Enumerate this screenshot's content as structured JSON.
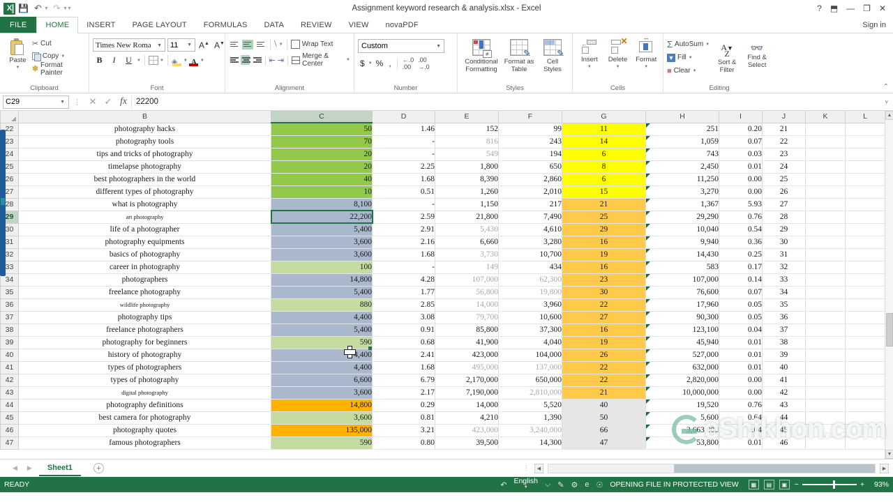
{
  "window": {
    "title": "Assignment keyword research & analysis.xlsx - Excel",
    "help": "?",
    "ribbon_display": "⬒",
    "minimize": "—",
    "restore": "❐",
    "close": "✕",
    "signin": "Sign in"
  },
  "qat": {
    "logo": "X",
    "save": "💾",
    "undo": "↶",
    "redo": "↷",
    "customize": "≡"
  },
  "tabs": [
    {
      "label": "FILE",
      "active": false
    },
    {
      "label": "HOME",
      "active": true
    },
    {
      "label": "INSERT",
      "active": false
    },
    {
      "label": "PAGE LAYOUT",
      "active": false
    },
    {
      "label": "FORMULAS",
      "active": false
    },
    {
      "label": "DATA",
      "active": false
    },
    {
      "label": "REVIEW",
      "active": false
    },
    {
      "label": "VIEW",
      "active": false
    },
    {
      "label": "novaPDF",
      "active": false
    }
  ],
  "ribbon": {
    "clipboard": {
      "label": "Clipboard",
      "paste": "Paste",
      "cut": "Cut",
      "copy": "Copy",
      "format_painter": "Format Painter",
      "launcher": "⤵"
    },
    "font": {
      "label": "Font",
      "font_name": "Times New Roma",
      "font_size": "11",
      "grow": "A",
      "shrink": "A",
      "bold": "B",
      "italic": "I",
      "underline": "U",
      "borders": "borders",
      "fill_color": "fill-color",
      "font_color": "A",
      "launcher": "⤵"
    },
    "alignment": {
      "label": "Alignment",
      "wrap_text": "Wrap Text",
      "merge_center": "Merge & Center",
      "launcher": "⤵"
    },
    "number": {
      "label": "Number",
      "format": "Custom",
      "currency": "$",
      "percent": "%",
      "comma": ",",
      "inc_dec": ".00",
      "dec_dec": ".0",
      "launcher": "⤵"
    },
    "styles": {
      "label": "Styles",
      "conditional_formatting": "Conditional\nFormatting",
      "conditional_formatting_l1": "Conditional",
      "conditional_formatting_l2": "Formatting",
      "format_as_table_l1": "Format as",
      "format_as_table_l2": "Table",
      "cell_styles_l1": "Cell",
      "cell_styles_l2": "Styles"
    },
    "cells": {
      "label": "Cells",
      "insert": "Insert",
      "delete": "Delete",
      "format": "Format"
    },
    "editing": {
      "label": "Editing",
      "autosum": "AutoSum",
      "fill": "Fill",
      "clear": "Clear",
      "sort_filter_l1": "Sort &",
      "sort_filter_l2": "Filter",
      "find_select_l1": "Find &",
      "find_select_l2": "Select"
    },
    "collapse": "⌃"
  },
  "formula_bar": {
    "name_box": "C29",
    "cancel": "✕",
    "enter": "✓",
    "insert_function": "fx",
    "value": "22200",
    "expand": "˅"
  },
  "grid": {
    "columns": [
      {
        "id": "B",
        "selected": false
      },
      {
        "id": "C",
        "selected": true
      },
      {
        "id": "D",
        "selected": false
      },
      {
        "id": "E",
        "selected": false
      },
      {
        "id": "F",
        "selected": false
      },
      {
        "id": "G",
        "selected": false
      },
      {
        "id": "H",
        "selected": false
      },
      {
        "id": "I",
        "selected": false
      },
      {
        "id": "J",
        "selected": false
      },
      {
        "id": "K",
        "selected": false
      },
      {
        "id": "L",
        "selected": false
      },
      {
        "id": "M",
        "selected": false
      }
    ],
    "selected_cell": "C29",
    "colors": {
      "green_fill": "#92c94a",
      "light_green_fill": "#c4dca0",
      "blue_gray_fill": "#a9b8cc",
      "yellow_fill": "#ffff00",
      "orange_fill": "#ffc94a",
      "orange_strong_fill": "#ffb300",
      "gray_fill": "#e6e6e6",
      "accent": "#217346"
    },
    "rows": [
      {
        "n": "22",
        "B": "photography hacks",
        "C": "50",
        "D": "1.46",
        "E": "152",
        "F": "99",
        "G": "11",
        "H": "251",
        "I": "0.20",
        "J": "21",
        "cfill": "green",
        "gfill": "yellow",
        "emuted": false,
        "fmuted": false,
        "bsmall": false
      },
      {
        "n": "23",
        "B": "photography tools",
        "C": "70",
        "D": "-",
        "E": "816",
        "F": "243",
        "G": "14",
        "H": "1,059",
        "I": "0.07",
        "J": "22",
        "cfill": "green",
        "gfill": "yellow",
        "emuted": true,
        "fmuted": false,
        "bsmall": false
      },
      {
        "n": "24",
        "B": "tips and tricks of photography",
        "C": "20",
        "D": "-",
        "E": "549",
        "F": "194",
        "G": "6",
        "H": "743",
        "I": "0.03",
        "J": "23",
        "cfill": "green",
        "gfill": "yellow",
        "emuted": true,
        "fmuted": false,
        "bsmall": false
      },
      {
        "n": "25",
        "B": "timelapse photography",
        "C": "20",
        "D": "2.25",
        "E": "1,800",
        "F": "650",
        "G": "8",
        "H": "2,450",
        "I": "0.01",
        "J": "24",
        "cfill": "green",
        "gfill": "yellow",
        "emuted": false,
        "fmuted": false,
        "bsmall": false
      },
      {
        "n": "26",
        "B": "best photographers in the world",
        "C": "40",
        "D": "1.68",
        "E": "8,390",
        "F": "2,860",
        "G": "6",
        "H": "11,250",
        "I": "0.00",
        "J": "25",
        "cfill": "green",
        "gfill": "yellow",
        "emuted": false,
        "fmuted": false,
        "bsmall": false
      },
      {
        "n": "27",
        "B": "different types of photography",
        "C": "10",
        "D": "0.51",
        "E": "1,260",
        "F": "2,010",
        "G": "15",
        "H": "3,270",
        "I": "0.00",
        "J": "26",
        "cfill": "green",
        "gfill": "yellow",
        "emuted": false,
        "fmuted": false,
        "bsmall": false
      },
      {
        "n": "28",
        "B": "what is photography",
        "C": "8,100",
        "D": "-",
        "E": "1,150",
        "F": "217",
        "G": "21",
        "H": "1,367",
        "I": "5.93",
        "J": "27",
        "cfill": "bluegray",
        "gfill": "orange",
        "emuted": false,
        "fmuted": false,
        "bsmall": false
      },
      {
        "n": "29",
        "B": "art photography",
        "C": "22,200",
        "D": "2.59",
        "E": "21,800",
        "F": "7,490",
        "G": "25",
        "H": "29,290",
        "I": "0.76",
        "J": "28",
        "cfill": "bluegray",
        "gfill": "orange",
        "emuted": false,
        "fmuted": false,
        "bsmall": true,
        "selected": true
      },
      {
        "n": "30",
        "B": "life of a photographer",
        "C": "5,400",
        "D": "2.91",
        "E": "5,430",
        "F": "4,610",
        "G": "29",
        "H": "10,040",
        "I": "0.54",
        "J": "29",
        "cfill": "bluegray",
        "gfill": "orange",
        "emuted": true,
        "fmuted": false,
        "bsmall": false
      },
      {
        "n": "31",
        "B": "photography equipments",
        "C": "3,600",
        "D": "2.16",
        "E": "6,660",
        "F": "3,280",
        "G": "16",
        "H": "9,940",
        "I": "0.36",
        "J": "30",
        "cfill": "bluegray",
        "gfill": "orange",
        "emuted": false,
        "fmuted": false,
        "bsmall": false
      },
      {
        "n": "32",
        "B": "basics of photography",
        "C": "3,600",
        "D": "1.68",
        "E": "3,730",
        "F": "10,700",
        "G": "19",
        "H": "14,430",
        "I": "0.25",
        "J": "31",
        "cfill": "bluegray",
        "gfill": "orange",
        "emuted": true,
        "fmuted": false,
        "bsmall": false
      },
      {
        "n": "33",
        "B": "career in photography",
        "C": "100",
        "D": "-",
        "E": "149",
        "F": "434",
        "G": "16",
        "H": "583",
        "I": "0.17",
        "J": "32",
        "cfill": "lightgreen",
        "gfill": "orange",
        "emuted": true,
        "fmuted": false,
        "bsmall": false
      },
      {
        "n": "34",
        "B": "photographers",
        "C": "14,800",
        "D": "4.28",
        "E": "107,000",
        "F": "62,300",
        "G": "23",
        "H": "107,000",
        "I": "0.14",
        "J": "33",
        "cfill": "bluegray",
        "gfill": "orange",
        "emuted": true,
        "fmuted": true,
        "bsmall": false
      },
      {
        "n": "35",
        "B": "freelance photography",
        "C": "5,400",
        "D": "1.77",
        "E": "56,800",
        "F": "19,800",
        "G": "30",
        "H": "76,600",
        "I": "0.07",
        "J": "34",
        "cfill": "bluegray",
        "gfill": "orange",
        "emuted": true,
        "fmuted": true,
        "bsmall": false
      },
      {
        "n": "36",
        "B": "wildlife photography",
        "C": "880",
        "D": "2.85",
        "E": "14,000",
        "F": "3,960",
        "G": "22",
        "H": "17,960",
        "I": "0.05",
        "J": "35",
        "cfill": "lightgreen",
        "gfill": "orange",
        "emuted": true,
        "fmuted": false,
        "bsmall": true
      },
      {
        "n": "37",
        "B": "photography tips",
        "C": "4,400",
        "D": "3.08",
        "E": "79,700",
        "F": "10,600",
        "G": "27",
        "H": "90,300",
        "I": "0.05",
        "J": "36",
        "cfill": "bluegray",
        "gfill": "orange",
        "emuted": true,
        "fmuted": false,
        "bsmall": false
      },
      {
        "n": "38",
        "B": "freelance photographers",
        "C": "5,400",
        "D": "0.91",
        "E": "85,800",
        "F": "37,300",
        "G": "16",
        "H": "123,100",
        "I": "0.04",
        "J": "37",
        "cfill": "bluegray",
        "gfill": "orange",
        "emuted": false,
        "fmuted": false,
        "bsmall": false
      },
      {
        "n": "39",
        "B": "photography for beginners",
        "C": "590",
        "D": "0.68",
        "E": "41,900",
        "F": "4,040",
        "G": "19",
        "H": "45,940",
        "I": "0.01",
        "J": "38",
        "cfill": "lightgreen",
        "gfill": "orange",
        "emuted": false,
        "fmuted": false,
        "bsmall": false
      },
      {
        "n": "40",
        "B": "history of photography",
        "C": "4,400",
        "D": "2.41",
        "E": "423,000",
        "F": "104,000",
        "G": "26",
        "H": "527,000",
        "I": "0.01",
        "J": "39",
        "cfill": "bluegray",
        "gfill": "orange",
        "emuted": false,
        "fmuted": false,
        "bsmall": false
      },
      {
        "n": "41",
        "B": "types of photographers",
        "C": "4,400",
        "D": "1.68",
        "E": "495,000",
        "F": "137,000",
        "G": "22",
        "H": "632,000",
        "I": "0.01",
        "J": "40",
        "cfill": "bluegray",
        "gfill": "orange",
        "emuted": true,
        "fmuted": true,
        "bsmall": false
      },
      {
        "n": "42",
        "B": "types of photography",
        "C": "6,600",
        "D": "6.79",
        "E": "2,170,000",
        "F": "650,000",
        "G": "22",
        "H": "2,820,000",
        "I": "0.00",
        "J": "41",
        "cfill": "bluegray",
        "gfill": "orange",
        "emuted": false,
        "fmuted": false,
        "bsmall": false
      },
      {
        "n": "43",
        "B": "digital photography",
        "C": "3,600",
        "D": "2.17",
        "E": "7,190,000",
        "F": "2,810,000",
        "G": "21",
        "H": "10,000,000",
        "I": "0.00",
        "J": "42",
        "cfill": "bluegray",
        "gfill": "orange",
        "emuted": false,
        "fmuted": true,
        "bsmall": true
      },
      {
        "n": "44",
        "B": "photography definitions",
        "C": "14,800",
        "D": "0.29",
        "E": "14,000",
        "F": "5,520",
        "G": "40",
        "H": "19,520",
        "I": "0.76",
        "J": "43",
        "cfill": "orangestrong",
        "gfill": "gray",
        "emuted": false,
        "fmuted": false,
        "bsmall": false
      },
      {
        "n": "45",
        "B": "best camera for photography",
        "C": "3,600",
        "D": "0.81",
        "E": "4,210",
        "F": "1,390",
        "G": "50",
        "H": "5,600",
        "I": "0.64",
        "J": "44",
        "cfill": "lightgreen",
        "gfill": "gray",
        "emuted": false,
        "fmuted": false,
        "bsmall": false
      },
      {
        "n": "46",
        "B": "photography quotes",
        "C": "135,000",
        "D": "3.21",
        "E": "423,000",
        "F": "3,240,000",
        "G": "66",
        "H": "3,663,000",
        "I": "0.04",
        "J": "45",
        "cfill": "orangestrong",
        "gfill": "gray",
        "emuted": true,
        "fmuted": true,
        "bsmall": false
      },
      {
        "n": "47",
        "B": "famous photographers",
        "C": "590",
        "D": "0.80",
        "E": "39,500",
        "F": "14,300",
        "G": "47",
        "H": "53,800",
        "I": "0.01",
        "J": "46",
        "cfill": "lightgreen",
        "gfill": "gray",
        "emuted": false,
        "fmuted": false,
        "bsmall": false
      }
    ]
  },
  "sheet_tabs": {
    "prev": "◀",
    "next": "▶",
    "tabs": [
      "Sheet1"
    ],
    "add": "+"
  },
  "hscroll": {
    "left": "◀",
    "right": "▶",
    "dots": "⋮"
  },
  "vscroll": {
    "up": "▲",
    "down": "▼"
  },
  "status": {
    "mode": "READY",
    "language": "English",
    "protected_view": "OPENING FILE IN PROTECTED VIEW",
    "view_normal": "▦",
    "view_layout": "▤",
    "view_break": "▣",
    "zoom_out": "−",
    "zoom_in": "+",
    "zoom": "93%"
  },
  "watermark": {
    "text": "eShikhon.com"
  }
}
